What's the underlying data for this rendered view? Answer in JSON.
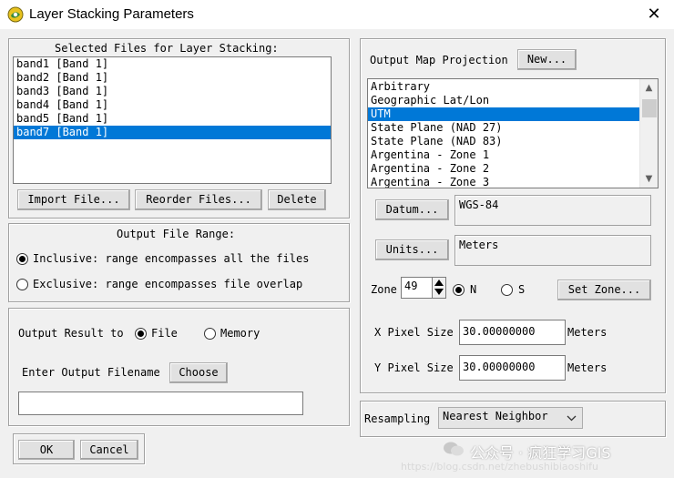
{
  "window": {
    "title": "Layer Stacking Parameters",
    "close_glyph": "✕"
  },
  "selected_files": {
    "heading": "Selected Files for Layer Stacking:",
    "items": [
      {
        "label": "band1 [Band 1]",
        "selected": false
      },
      {
        "label": "band2 [Band 1]",
        "selected": false
      },
      {
        "label": "band3 [Band 1]",
        "selected": false
      },
      {
        "label": "band4 [Band 1]",
        "selected": false
      },
      {
        "label": "band5 [Band 1]",
        "selected": false
      },
      {
        "label": "band7 [Band 1]",
        "selected": true
      }
    ],
    "import_button": "Import File...",
    "reorder_button": "Reorder Files...",
    "delete_button": "Delete"
  },
  "output_range": {
    "heading": "Output File Range:",
    "inclusive_label": "Inclusive: range encompasses all the files",
    "exclusive_label": "Exclusive: range encompasses file overlap",
    "selected": "inclusive"
  },
  "output_result": {
    "label": "Output Result to",
    "file_label": "File",
    "memory_label": "Memory",
    "selected": "file",
    "filename_label": "Enter Output Filename",
    "choose_button": "Choose",
    "filename_value": ""
  },
  "footer": {
    "ok_button": "OK",
    "cancel_button": "Cancel"
  },
  "projection": {
    "label": "Output Map Projection",
    "new_button": "New...",
    "items": [
      {
        "label": "Arbitrary",
        "selected": false
      },
      {
        "label": "Geographic Lat/Lon",
        "selected": false
      },
      {
        "label": "UTM",
        "selected": true
      },
      {
        "label": "State Plane (NAD 27)",
        "selected": false
      },
      {
        "label": "State Plane (NAD 83)",
        "selected": false
      },
      {
        "label": "Argentina - Zone 1",
        "selected": false
      },
      {
        "label": "Argentina - Zone 2",
        "selected": false
      },
      {
        "label": "Argentina - Zone 3",
        "selected": false
      }
    ],
    "datum_button": "Datum...",
    "datum_value": "WGS-84",
    "units_button": "Units...",
    "units_value": "Meters",
    "zone_label": "Zone",
    "zone_value": "49",
    "north_label": "N",
    "south_label": "S",
    "hemisphere": "N",
    "set_zone_button": "Set Zone...",
    "x_pixel_label": "X Pixel Size",
    "x_pixel_value": "30.00000000",
    "x_pixel_unit": "Meters",
    "y_pixel_label": "Y Pixel Size",
    "y_pixel_value": "30.00000000",
    "y_pixel_unit": "Meters"
  },
  "resampling": {
    "label": "Resampling",
    "value": "Nearest Neighbor"
  },
  "watermark": {
    "line1": "公众号 · 疯狂学习GIS",
    "line2": "https://blog.csdn.net/zhebushibiaoshifu"
  }
}
